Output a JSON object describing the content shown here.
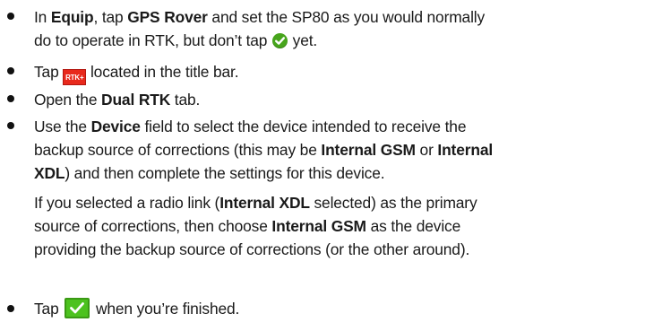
{
  "steps": [
    {
      "line1": {
        "t1": "In ",
        "b1": "Equip",
        "t2": ", tap ",
        "b2": "GPS Rover",
        "t3": " and set the SP80 as you would normally"
      },
      "line2": {
        "t1": "do to operate in RTK, but don’t tap ",
        "t2": " yet."
      },
      "icon": "green-check-circle-icon"
    },
    {
      "t1": "Tap ",
      "icon_label": "RTK+",
      "t2": " located in the title bar."
    },
    {
      "t1": "Open the ",
      "b1": "Dual RTK",
      "t2": " tab."
    },
    {
      "line1": {
        "t1": "Use the ",
        "b1": "Device",
        "t2": " field to select the device intended to receive the"
      },
      "line2": {
        "t1": "backup source of corrections (this may be ",
        "b1": "Internal GSM",
        "t2": " or ",
        "b2": "Internal"
      },
      "line3": {
        "b1": "XDL",
        "t1": ") and then complete the settings for this device."
      },
      "para2": {
        "line1": {
          "t1": "If you selected a radio link (",
          "b1": "Internal XDL",
          "t2": " selected) as the primary"
        },
        "line2": {
          "t1": "source of corrections, then choose ",
          "b1": "Internal GSM",
          "t2": " as the device"
        },
        "line3": {
          "t1": "providing the backup source of corrections (or the other around)."
        }
      }
    },
    {
      "t1": "Tap ",
      "t2": " when you’re finished.",
      "icon": "green-checkbox-validate-icon"
    }
  ]
}
